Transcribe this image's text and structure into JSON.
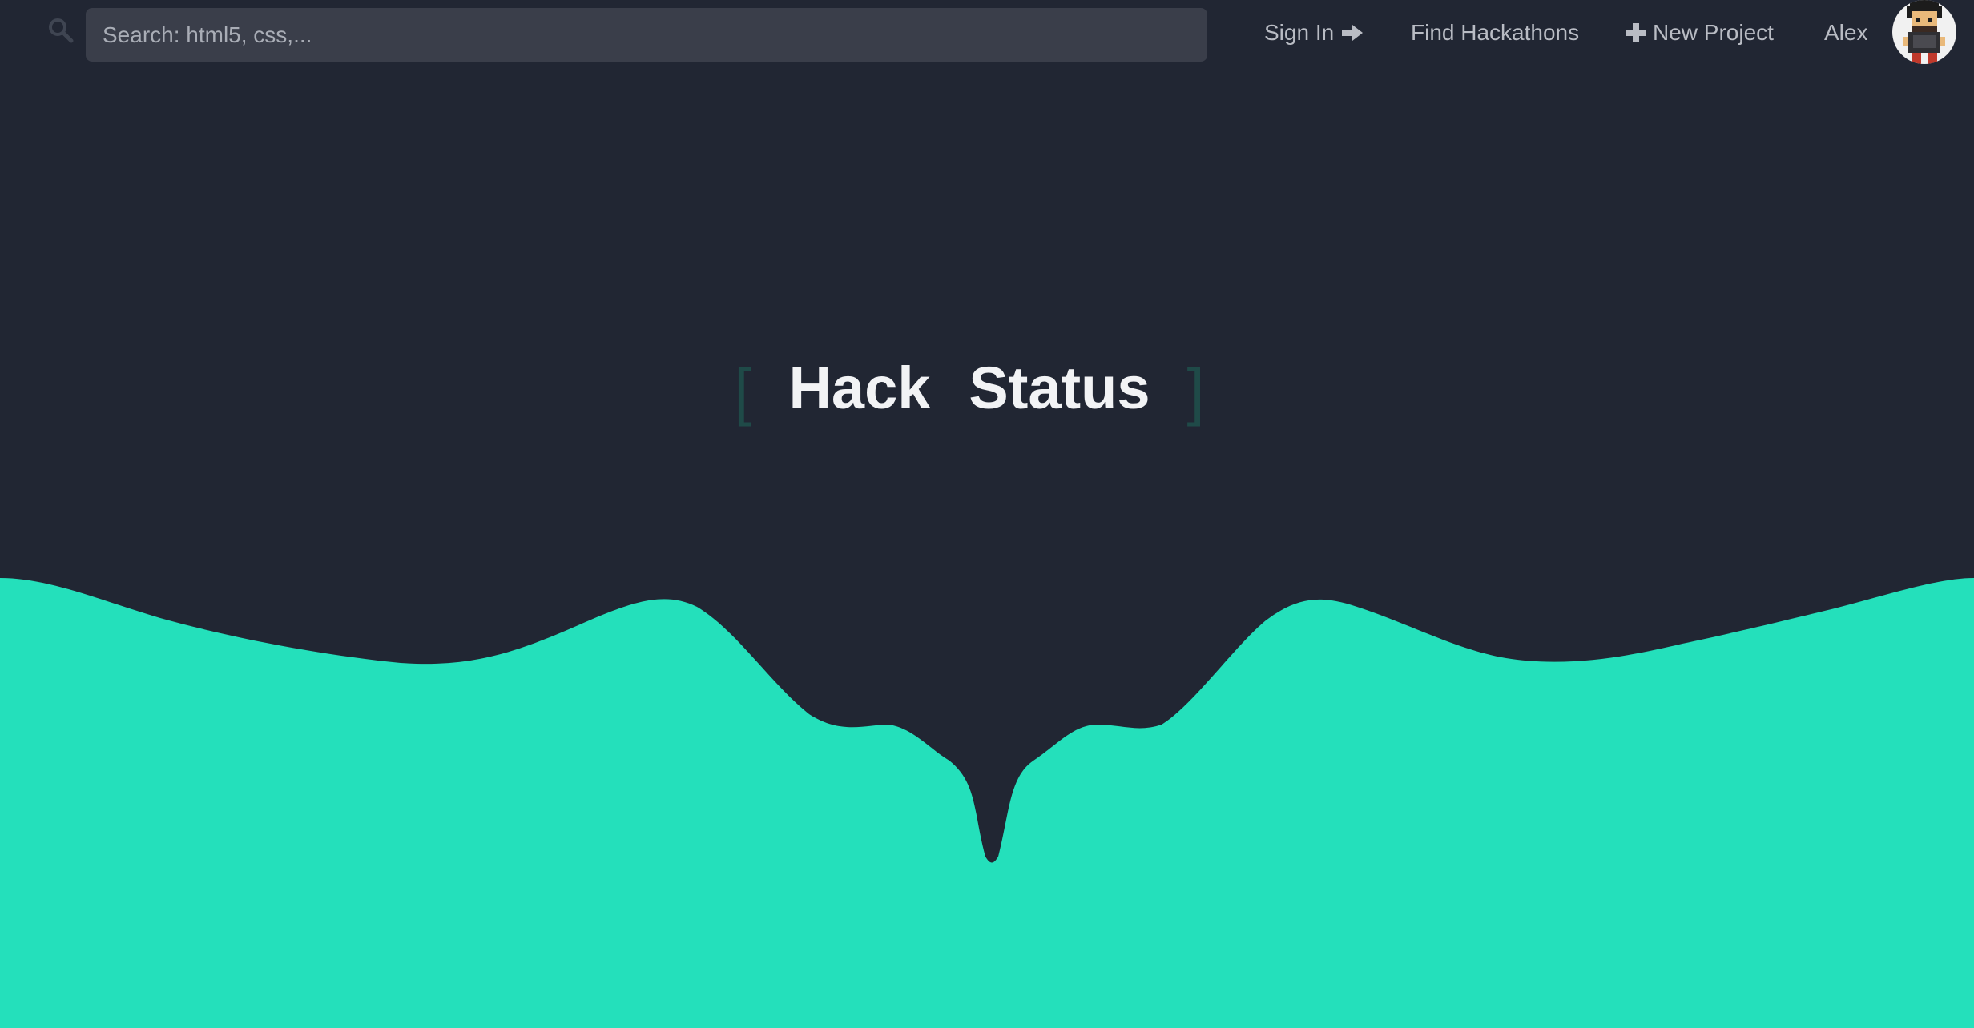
{
  "search": {
    "placeholder": "Search: html5, css,..."
  },
  "nav": {
    "sign_in": "Sign In",
    "find_hackathons": "Find Hackathons",
    "new_project": "New Project",
    "user_name": "Alex"
  },
  "hero": {
    "title_word_1": "Hack",
    "title_word_2": "Status",
    "bracket_open": "[",
    "bracket_close": "]"
  },
  "icons": {
    "search": "search-icon",
    "sign_in": "arrow-right-icon",
    "new_project": "plus-icon"
  },
  "colors": {
    "background": "#212633",
    "accent": "#24e0bb",
    "nav_text": "#b9bcc4",
    "search_bg": "#3a3e4a",
    "bracket": "#1f4a48"
  }
}
